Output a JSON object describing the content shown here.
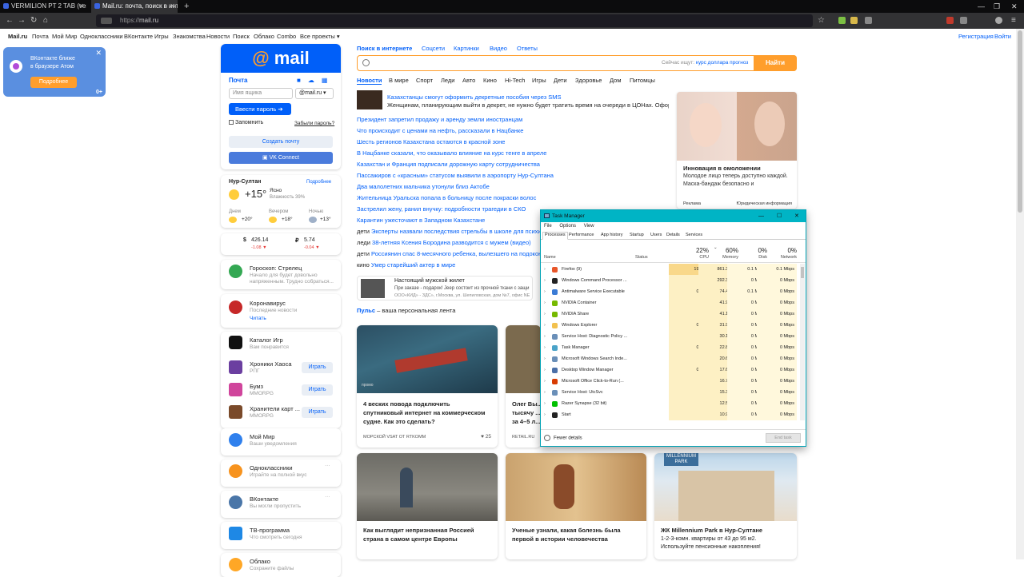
{
  "browser": {
    "tabs": [
      {
        "title": "VERMILION PT 2 TAB (ver 7) by"
      },
      {
        "title": "Mail.ru: почта, поиск в интерне"
      }
    ],
    "url_prefix": "https://",
    "url_host": "mail.ru"
  },
  "topnav": {
    "items": [
      "Mail.ru",
      "Почта",
      "Мой Мир",
      "Одноклассники",
      "ВКонтакте",
      "Игры",
      "Знакомства",
      "Новости",
      "Поиск",
      "Облако",
      "Combo",
      "Все проекты ▾"
    ],
    "register": "Регистрация",
    "login": "Войти"
  },
  "vk_popup": {
    "line1": "ВКонтакте ближе",
    "line2": "в браузере Атом",
    "button": "Подробнее",
    "age": "0+"
  },
  "login": {
    "logo": "mail",
    "title": "Почта",
    "username_placeholder": "Имя ящика",
    "domain": "@mail.ru",
    "submit": "Ввести пароль",
    "remember": "Запомнить",
    "forgot": "Забыли пароль?",
    "create": "Создать почту",
    "vk": "VK Connect"
  },
  "weather": {
    "city": "Нур-Султан",
    "more": "Подробнее",
    "temp": "+15°",
    "cond": "Ясно",
    "humidity": "Влажность 39%",
    "forecast": [
      {
        "label": "Днем",
        "temp": "+20°"
      },
      {
        "label": "Вечером",
        "temp": "+18°"
      },
      {
        "label": "Ночью",
        "temp": "+13°"
      }
    ]
  },
  "currency": {
    "usd": "426.14",
    "usd_ch": "-1.08 ▼",
    "rub": "5.74",
    "rub_ch": "-0.04 ▼"
  },
  "services": [
    {
      "title": "Гороскоп: Стрелец",
      "sub1": "Начало для будет довольно",
      "sub2": "напряженным. Трудно собраться..."
    },
    {
      "title": "Коронавирус",
      "sub1": "Последние новости",
      "sub2": "Читать"
    },
    {
      "title": "Каталог Игр",
      "sub1": "Вам понравится"
    },
    {
      "title": "Хроники Хаоса",
      "sub1": "РПГ",
      "btn": "Играть"
    },
    {
      "title": "Бумз",
      "sub1": "MMORPG",
      "btn": "Играть"
    },
    {
      "title": "Хранители карт ...",
      "sub1": "MMORPG",
      "btn": "Играть"
    },
    {
      "title": "Мой Мир",
      "sub1": "Ваши уведомления"
    },
    {
      "title": "Одноклассники",
      "sub1": "Играйте на полной вкус"
    },
    {
      "title": "ВКонтакте",
      "sub1": "Вы могли пропустить"
    },
    {
      "title": "ТВ-программа",
      "sub1": "Что смотреть сегодня"
    },
    {
      "title": "Облако",
      "sub1": "Сохраните файлы"
    }
  ],
  "search": {
    "tabs": [
      "Поиск в интернете",
      "Соцсети",
      "Картинки",
      "Видео",
      "Ответы"
    ],
    "hint": "Сейчас ищут:",
    "hint_query": "курс доллара прогноз",
    "button": "Найти"
  },
  "news": {
    "tabs": [
      "Новости",
      "В мире",
      "Спорт",
      "Леди",
      "Авто",
      "Кино",
      "Hi-Tech",
      "Игры",
      "Дети",
      "Здоровье",
      "Дом",
      "Питомцы"
    ],
    "top_title": "Казахстанцы смогут оформить декретные пособия через SMS",
    "top_sub": "Женщинам, планирующим выйти в декрет, не нужно будет тратить время на очереди в ЦОНах. Оформ",
    "items": [
      {
        "pref": "",
        "text": "Президент запретил продажу и аренду земли иностранцам"
      },
      {
        "pref": "",
        "text": "Что происходит с ценами на нефть, рассказали в Нацбанке"
      },
      {
        "pref": "",
        "text": "Шесть регионов Казахстана остаются в красной зоне"
      },
      {
        "pref": "",
        "text": "В Нацбанке сказали, что оказывало влияние на курс тенге в апреле"
      },
      {
        "pref": "",
        "text": "Казахстан и Франция подписали дорожную карту сотрудничества"
      },
      {
        "pref": "",
        "text": "Пассажиров с «красным» статусом выявили в аэропорту Нур-Султана"
      },
      {
        "pref": "",
        "text": "Два малолетних мальчика утонули близ Актобе"
      },
      {
        "pref": "",
        "text": "Жительница Уральска попала в больницу после покраски волос"
      },
      {
        "pref": "",
        "text": "Застрелил жену, ранил внучку: подробности трагедии в СКО"
      },
      {
        "pref": "",
        "text": "Карантин ужесточают в Западном Казахстане"
      },
      {
        "pref": "дети",
        "text": "Эксперты назвали последствия стрельбы в школе для психик"
      },
      {
        "pref": "леди",
        "text": "38-летняя Ксения Бородина разводится с мужем (видео)"
      },
      {
        "pref": "дети",
        "text": "Россиянин спас 8-месячного ребенка, вылезшего на подокон"
      },
      {
        "pref": "кино",
        "text": "Умер старейший актер в мире"
      }
    ]
  },
  "ad1": {
    "title": "Инновация в омоложении",
    "text": "Молодое лицо теперь доступно каждой. Маска-бандаж безопасно и",
    "label": "Реклама",
    "label2": "Юридическая информация"
  },
  "ad2": {
    "title": "Настоящий мужской жилет",
    "text": "При заказе - подарок! Jeep состоит из прочной ткани с защи",
    "addr": "ООО«КИД» - ЗДС», г.Москва, ул. Шепиловская, дом №7, офис NE"
  },
  "pulse": {
    "brand": "Пульс",
    "text": " – ваша персональная лента"
  },
  "pulse_cards": [
    {
      "title": "4 веских повода подключить спутниковый интернет на коммерческом судне. Как это сделать?",
      "source": "МОРСКОЙ VSAT ОТ RTKOMM",
      "likes": "25",
      "tag": "промо"
    },
    {
      "title": "Олег Вы... тысячу ... за 4–5 л...",
      "source": "RETAIL.RU"
    },
    {
      "title": "Как выглядит непризнанная Россией страна в самом центре Европы"
    },
    {
      "title": "Ученые узнали, какая болезнь была первой в истории человечества"
    },
    {
      "title": "ЖК Millennium Park в Нур-Султане",
      "text1": "1-2-3-комн. квартиры от 43 до 95 м2.",
      "text2": "Используйте пенсионные накопления!",
      "img_text1": "MILLENNIUM",
      "img_text2": "PARK"
    }
  ],
  "task_manager": {
    "title": "Task Manager",
    "menu": [
      "File",
      "Options",
      "View"
    ],
    "tabs": [
      "Processes",
      "Performance",
      "App history",
      "Startup",
      "Users",
      "Details",
      "Services"
    ],
    "columns": {
      "name": "Name",
      "status": "Status"
    },
    "cpu": {
      "pct": "22%",
      "label": "CPU"
    },
    "memory": {
      "pct": "60%",
      "label": "Memory"
    },
    "disk": {
      "pct": "0%",
      "label": "Disk"
    },
    "network": {
      "pct": "0%",
      "label": "Network"
    },
    "rows": [
      {
        "name": "Firefox (9)",
        "cpu": "19.8%",
        "mem": "861.3 MB",
        "disk": "0.1 MB/s",
        "net": "0.1 Mbps",
        "icon_color": "#e8562a"
      },
      {
        "name": "Windows Command Processor ...",
        "cpu": "0%",
        "mem": "292.3 MB",
        "disk": "0 MB/s",
        "net": "0 Mbps",
        "icon_color": "#222222"
      },
      {
        "name": "Antimalware Service Executable",
        "cpu": "0.1%",
        "mem": "74.4 MB",
        "disk": "0.1 MB/s",
        "net": "0 Mbps",
        "icon_color": "#3a7bd5"
      },
      {
        "name": "NVIDIA Container",
        "cpu": "0%",
        "mem": "41.9 MB",
        "disk": "0 MB/s",
        "net": "0 Mbps",
        "icon_color": "#76b900"
      },
      {
        "name": "NVIDIA Share",
        "cpu": "0%",
        "mem": "41.1 MB",
        "disk": "0 MB/s",
        "net": "0 Mbps",
        "icon_color": "#76b900"
      },
      {
        "name": "Windows Explorer",
        "cpu": "0.1%",
        "mem": "31.9 MB",
        "disk": "0 MB/s",
        "net": "0 Mbps",
        "icon_color": "#f2c14e"
      },
      {
        "name": "Service Host: Diagnostic Policy ...",
        "cpu": "0%",
        "mem": "30.1 MB",
        "disk": "0 MB/s",
        "net": "0 Mbps",
        "icon_color": "#6a8fb8"
      },
      {
        "name": "Task Manager",
        "cpu": "0.2%",
        "mem": "22.8 MB",
        "disk": "0 MB/s",
        "net": "0 Mbps",
        "icon_color": "#4aa3c8"
      },
      {
        "name": "Microsoft Windows Search Inde...",
        "cpu": "0%",
        "mem": "20.6 MB",
        "disk": "0 MB/s",
        "net": "0 Mbps",
        "icon_color": "#6a8fb8"
      },
      {
        "name": "Desktop Window Manager",
        "cpu": "0.5%",
        "mem": "17.6 MB",
        "disk": "0 MB/s",
        "net": "0 Mbps",
        "icon_color": "#4a6fa8"
      },
      {
        "name": "Microsoft Office Click-to-Run (...",
        "cpu": "0%",
        "mem": "16.7 MB",
        "disk": "0 MB/s",
        "net": "0 Mbps",
        "icon_color": "#d83b01"
      },
      {
        "name": "Service Host: UtcSvc",
        "cpu": "0%",
        "mem": "15.3 MB",
        "disk": "0 MB/s",
        "net": "0 Mbps",
        "icon_color": "#6a8fb8"
      },
      {
        "name": "Razer Synapse (32 bit)",
        "cpu": "0%",
        "mem": "12.5 MB",
        "disk": "0 MB/s",
        "net": "0 Mbps",
        "icon_color": "#00c000"
      },
      {
        "name": "Start",
        "cpu": "0%",
        "mem": "10.9 MB",
        "disk": "0 MB/s",
        "net": "0 Mbps",
        "icon_color": "#222222"
      }
    ],
    "fewer": "Fewer details",
    "end_task": "End task"
  }
}
